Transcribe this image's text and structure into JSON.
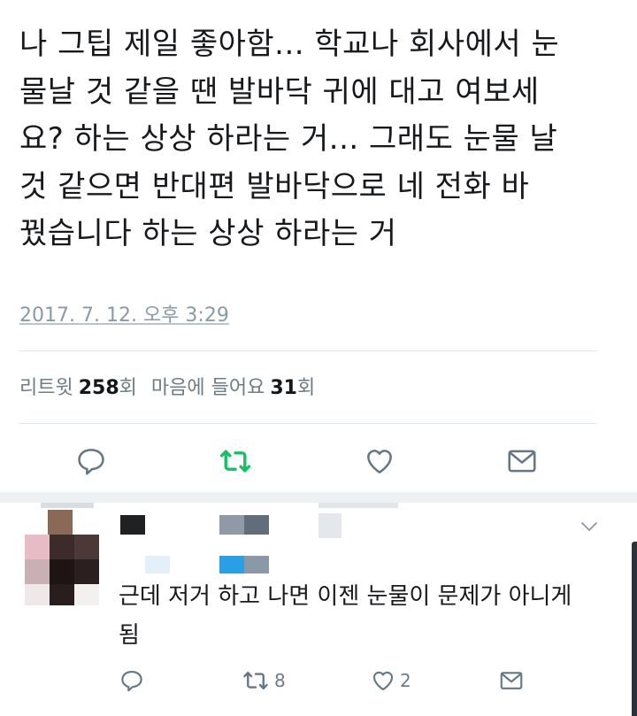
{
  "tweet": {
    "text": "나 그팁 제일 좋아함... 학교나 회사에서 눈\n물날 것 같을 땐 발바닥 귀에 대고 여보세\n요? 하는 상상 하라는 거... 그래도 눈물 날\n것 같으면 반대편 발바닥으로 네 전화 바\n꿨습니다 하는 상상 하라는 거",
    "date": "2017. 7. 12. 오후 3:29",
    "retweet_label": "리트윗",
    "retweet_count": "258",
    "like_label": "마음에 들어요",
    "like_count": "31",
    "count_unit": "회"
  },
  "actions": {
    "reply_icon": "reply-icon",
    "retweet_icon": "retweet-icon",
    "like_icon": "heart-icon",
    "dm_icon": "mail-icon",
    "retweet_color": "#17bf63",
    "icon_color": "#657786"
  },
  "reply": {
    "text": "근데 저거 하고 나면 이젠 눈물이 문제가 아니게\n됨",
    "retweet_count": "8",
    "like_count": "2",
    "caret_icon": "chevron-down-icon"
  }
}
